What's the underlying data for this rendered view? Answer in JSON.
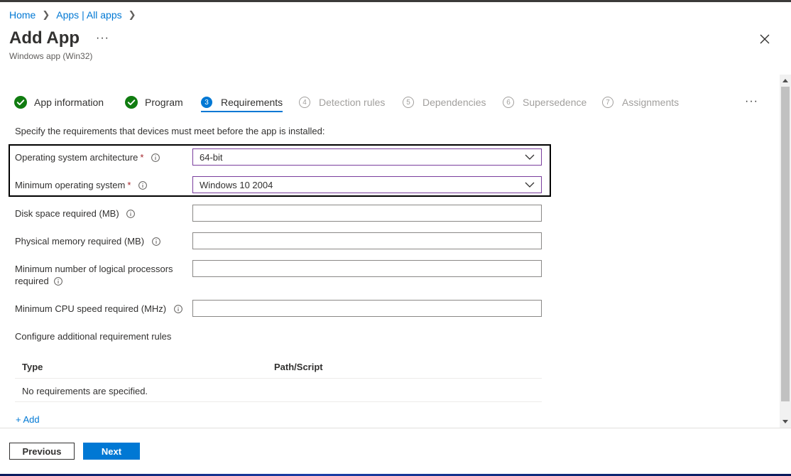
{
  "breadcrumb": {
    "home": "Home",
    "apps": "Apps | All apps"
  },
  "header": {
    "title": "Add App",
    "more": "···",
    "subtitle": "Windows app (Win32)"
  },
  "tabs": [
    {
      "label": "App information",
      "state": "done"
    },
    {
      "label": "Program",
      "state": "done"
    },
    {
      "num": "3",
      "label": "Requirements",
      "state": "active"
    },
    {
      "num": "4",
      "label": "Detection rules",
      "state": "pending"
    },
    {
      "num": "5",
      "label": "Dependencies",
      "state": "pending"
    },
    {
      "num": "6",
      "label": "Supersedence",
      "state": "pending"
    },
    {
      "num": "7",
      "label": "Assignments",
      "state": "pending"
    }
  ],
  "tabs_more": "···",
  "form": {
    "intro": "Specify the requirements that devices must meet before the app is installed:",
    "os_arch_label": "Operating system architecture",
    "os_arch_value": "64-bit",
    "min_os_label": "Minimum operating system",
    "min_os_value": "Windows 10 2004",
    "required_mark": "*",
    "disk_label": "Disk space required (MB)",
    "memory_label": "Physical memory required (MB)",
    "processors_label_line1": "Minimum number of logical processors",
    "processors_label_line2": "required",
    "cpu_label": "Minimum CPU speed required (MHz)",
    "disk_value": "",
    "memory_value": "",
    "processors_value": "",
    "cpu_value": ""
  },
  "rules": {
    "section_label": "Configure additional requirement rules",
    "col_type": "Type",
    "col_path": "Path/Script",
    "empty": "No requirements are specified.",
    "add_label": "+ Add"
  },
  "footer": {
    "previous": "Previous",
    "next": "Next"
  },
  "colors": {
    "accent": "#0078d4",
    "success": "#107c10",
    "required": "#a4262c",
    "focus_border": "#7a3e9d"
  },
  "icons": {
    "breadcrumb_sep": "chevron-right-icon",
    "close": "close-icon",
    "done_step": "checkmark-circle-icon",
    "info": "info-icon",
    "dropdown": "chevron-down-icon"
  }
}
